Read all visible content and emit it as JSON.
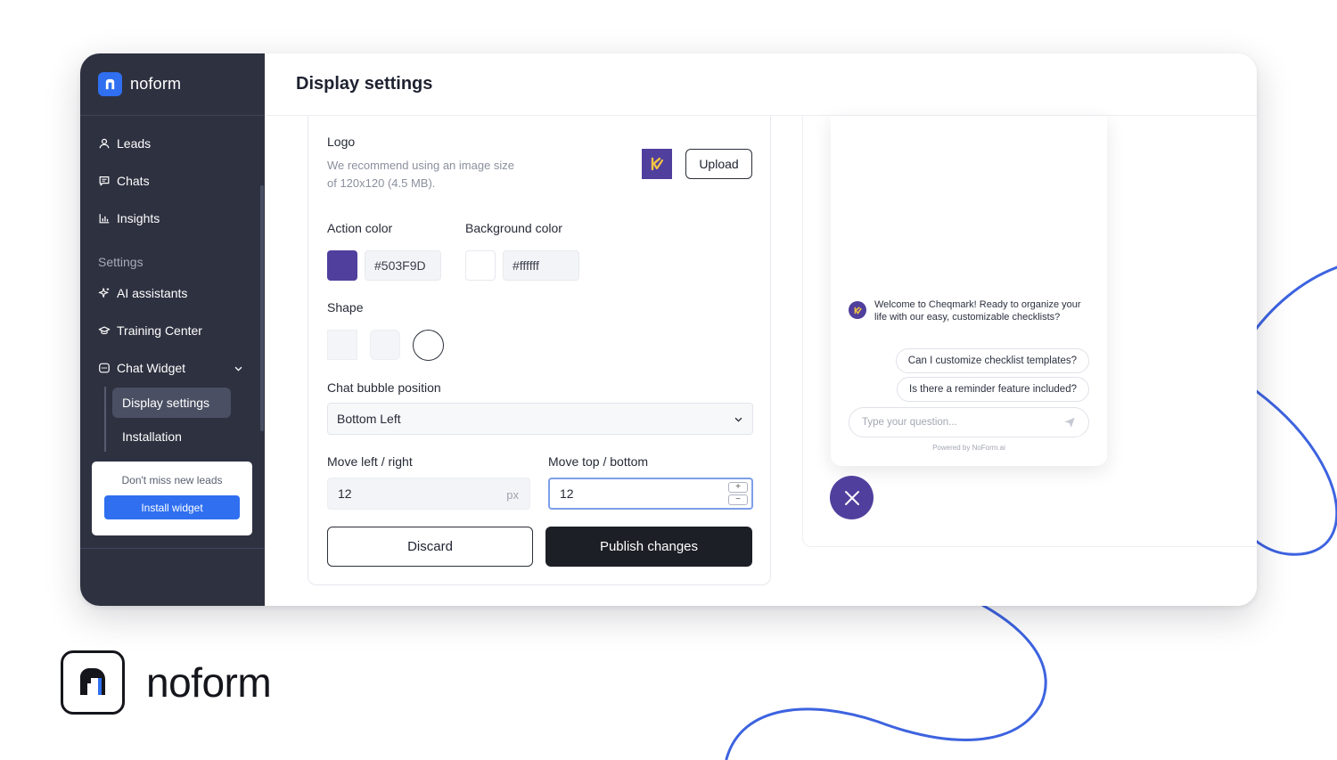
{
  "brand": {
    "name": "noform"
  },
  "sidebar": {
    "items": [
      {
        "label": "Leads",
        "icon": "user-icon"
      },
      {
        "label": "Chats",
        "icon": "chat-icon"
      },
      {
        "label": "Insights",
        "icon": "bar-chart-icon"
      }
    ],
    "section_label": "Settings",
    "settings_items": [
      {
        "label": "AI assistants",
        "icon": "sparkle-icon"
      },
      {
        "label": "Training Center",
        "icon": "graduation-cap-icon"
      },
      {
        "label": "Chat Widget",
        "icon": "widget-icon"
      }
    ],
    "chat_widget_subitems": [
      {
        "label": "Display settings",
        "active": true
      },
      {
        "label": "Installation",
        "active": false
      }
    ],
    "promo": {
      "text": "Don't miss new leads",
      "button": "Install widget"
    }
  },
  "page": {
    "title": "Display settings"
  },
  "form": {
    "logo": {
      "label": "Logo",
      "hint_line1": "We recommend using an image size",
      "hint_line2": "of 120x120 (4.5 MB).",
      "upload_label": "Upload"
    },
    "action_color": {
      "label": "Action color",
      "value": "#503F9D"
    },
    "background_color": {
      "label": "Background color",
      "value": "#ffffff"
    },
    "shape": {
      "label": "Shape"
    },
    "bubble_position": {
      "label": "Chat bubble position",
      "value": "Bottom Left"
    },
    "move_lr": {
      "label": "Move left / right",
      "value": "12",
      "unit": "px"
    },
    "move_tb": {
      "label": "Move top / bottom",
      "value": "12"
    },
    "discard_label": "Discard",
    "publish_label": "Publish changes"
  },
  "preview": {
    "bot_message": "Welcome to Cheqmark! Ready to organize your life with our easy, customizable checklists?",
    "suggestions": [
      "Can I customize checklist templates?",
      "Is there a reminder feature included?"
    ],
    "input_placeholder": "Type your question...",
    "powered_by": "Powered by NoForm.ai"
  },
  "colors": {
    "accent": "#503F9D",
    "brand_blue": "#2F6FF0",
    "sidebar_bg": "#2E3140",
    "decor_blue": "#3D63E0"
  }
}
